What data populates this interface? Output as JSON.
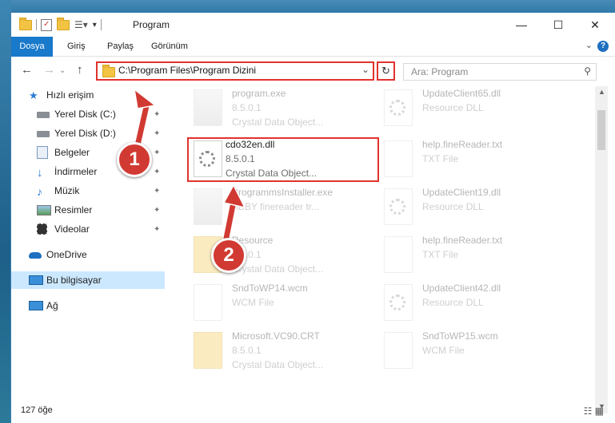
{
  "window": {
    "title": "Program"
  },
  "ribbon": {
    "tabs": [
      "Dosya",
      "Giriş",
      "Paylaş",
      "Görünüm"
    ],
    "help": "?"
  },
  "nav_buttons": {
    "back": "←",
    "forward": "→",
    "up": "↑"
  },
  "address": {
    "path": "C:\\Program Files\\Program Dizini",
    "dropdown": "⌄",
    "refresh": "↻"
  },
  "search": {
    "placeholder": "Ara: Program",
    "icon": "search-icon"
  },
  "sidebar": {
    "items": [
      {
        "label": "Hızlı erişim",
        "icon": "star-icon",
        "pinned": false
      },
      {
        "label": "Yerel Disk (C:)",
        "icon": "drive-icon",
        "pinned": true
      },
      {
        "label": "Yerel Disk (D:)",
        "icon": "drive-icon",
        "pinned": true
      },
      {
        "label": "Belgeler",
        "icon": "documents-icon",
        "pinned": true
      },
      {
        "label": "İndirmeler",
        "icon": "download-icon",
        "pinned": true
      },
      {
        "label": "Müzik",
        "icon": "music-icon",
        "pinned": true
      },
      {
        "label": "Resimler",
        "icon": "pictures-icon",
        "pinned": true
      },
      {
        "label": "Videolar",
        "icon": "videos-icon",
        "pinned": true
      },
      {
        "label": "OneDrive",
        "icon": "cloud-icon",
        "pinned": false
      },
      {
        "label": "Bu bilgisayar",
        "icon": "computer-icon",
        "pinned": false,
        "selected": true
      },
      {
        "label": "Ağ",
        "icon": "network-icon",
        "pinned": false
      }
    ],
    "pin_glyph": "📌"
  },
  "files": [
    {
      "name": "program.exe",
      "line2": "8.5.0.1",
      "line3": "Crystal Data Object...",
      "faded": true
    },
    {
      "name": "UpdateClient65.dll",
      "line2": "Resource DLL",
      "line3": "",
      "faded": true
    },
    {
      "name": "cdo32en.dll",
      "line2": "8.5.0.1",
      "line3": "Crystal Data Object...",
      "faded": false,
      "highlighted": true
    },
    {
      "name": "help.fineReader.txt",
      "line2": "TXT File",
      "line3": "",
      "faded": true
    },
    {
      "name": "ProgrammsInstaller.exe",
      "line2": "ABBY finereader tr...",
      "line3": "",
      "faded": true
    },
    {
      "name": "UpdateClient19.dll",
      "line2": "Resource DLL",
      "line3": "",
      "faded": true
    },
    {
      "name": "Resource",
      "line2": "8.5.0.1",
      "line3": "Crystal Data Object...",
      "faded": true
    },
    {
      "name": "help.fineReader.txt",
      "line2": "TXT File",
      "line3": "",
      "faded": true
    },
    {
      "name": "SndToWP14.wcm",
      "line2": "WCM File",
      "line3": "",
      "faded": true
    },
    {
      "name": "UpdateClient42.dll",
      "line2": "Resource DLL",
      "line3": "",
      "faded": true
    },
    {
      "name": "Microsoft.VC90.CRT",
      "line2": "8.5.0.1",
      "line3": "Crystal Data Object...",
      "faded": true
    },
    {
      "name": "SndToWP15.wcm",
      "line2": "WCM File",
      "line3": "",
      "faded": true
    }
  ],
  "status": {
    "count": "127 öğe"
  },
  "annotations": [
    {
      "label": "1",
      "color": "#d13a32"
    },
    {
      "label": "2",
      "color": "#d13a32"
    }
  ]
}
